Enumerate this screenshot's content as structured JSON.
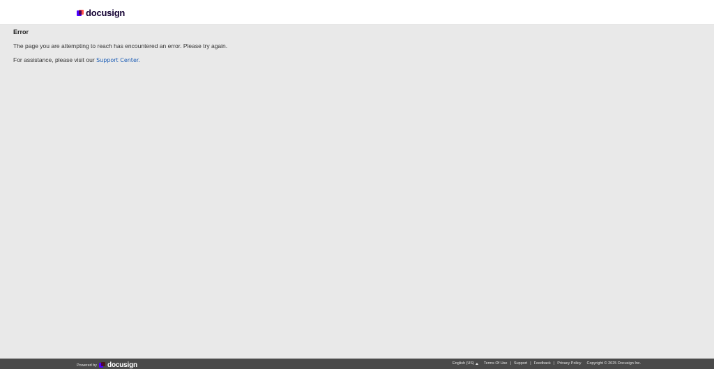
{
  "header": {
    "brand": "docusign"
  },
  "main": {
    "title": "Error",
    "message": "The page you are attempting to reach has encountered an error. Please try again.",
    "assist_prefix": "For assistance, please visit our ",
    "support_link": "Support Center.",
    "support_link_color": "#1d5eb6"
  },
  "footer": {
    "powered_by": "Powered by",
    "brand": "docusign",
    "language": "English (US)",
    "links": [
      "Terms Of Use",
      "Support",
      "Feedback",
      "Privacy Policy"
    ],
    "copyright": "Copyright © 2025 Docusign Inc."
  },
  "colors": {
    "page_bg": "#e9e9e9",
    "footer_bg": "#4a4a4a",
    "brand_purple": "#4c00ff",
    "brand_red": "#ff5252"
  }
}
